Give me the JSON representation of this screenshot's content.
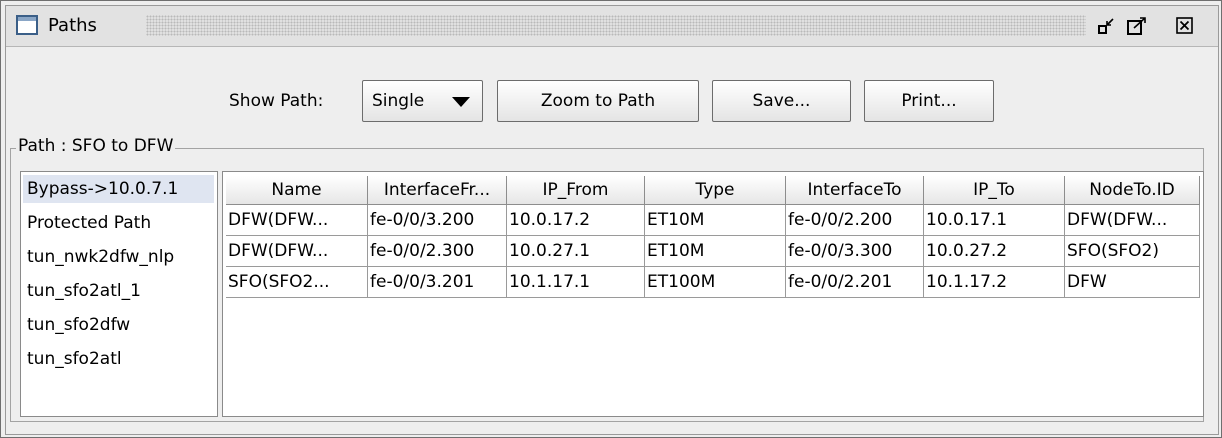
{
  "window": {
    "title": "Paths"
  },
  "toolbar": {
    "show_path_label": "Show Path:",
    "show_path_value": "Single",
    "zoom_label": "Zoom to Path",
    "save_label": "Save...",
    "print_label": "Print..."
  },
  "group": {
    "title": "Path : SFO to DFW"
  },
  "paths": [
    {
      "label": "Bypass->10.0.7.1",
      "selected": true
    },
    {
      "label": "Protected Path"
    },
    {
      "label": "tun_nwk2dfw_nlp"
    },
    {
      "label": "tun_sfo2atl_1"
    },
    {
      "label": "tun_sfo2dfw"
    },
    {
      "label": "tun_sfo2atl"
    }
  ],
  "table": {
    "headers": [
      "Name",
      "InterfaceFr...",
      "IP_From",
      "Type",
      "InterfaceTo",
      "IP_To",
      "NodeTo.ID"
    ],
    "rows": [
      [
        "DFW(DFW...",
        "fe-0/0/3.200",
        "10.0.17.2",
        "ET10M",
        "fe-0/0/2.200",
        "10.0.17.1",
        "DFW(DFW..."
      ],
      [
        "DFW(DFW...",
        "fe-0/0/2.300",
        "10.0.27.1",
        "ET10M",
        "fe-0/0/3.300",
        "10.0.27.2",
        "SFO(SFO2)"
      ],
      [
        "SFO(SFO2...",
        "fe-0/0/3.201",
        "10.1.17.1",
        "ET100M",
        "fe-0/0/2.201",
        "10.1.17.2",
        "DFW"
      ]
    ]
  },
  "icons": {
    "window": "window-icon",
    "minimize": "minimize-icon",
    "maximize": "maximize-icon",
    "close": "close-icon",
    "dropdown": "dropdown-arrow-icon"
  }
}
